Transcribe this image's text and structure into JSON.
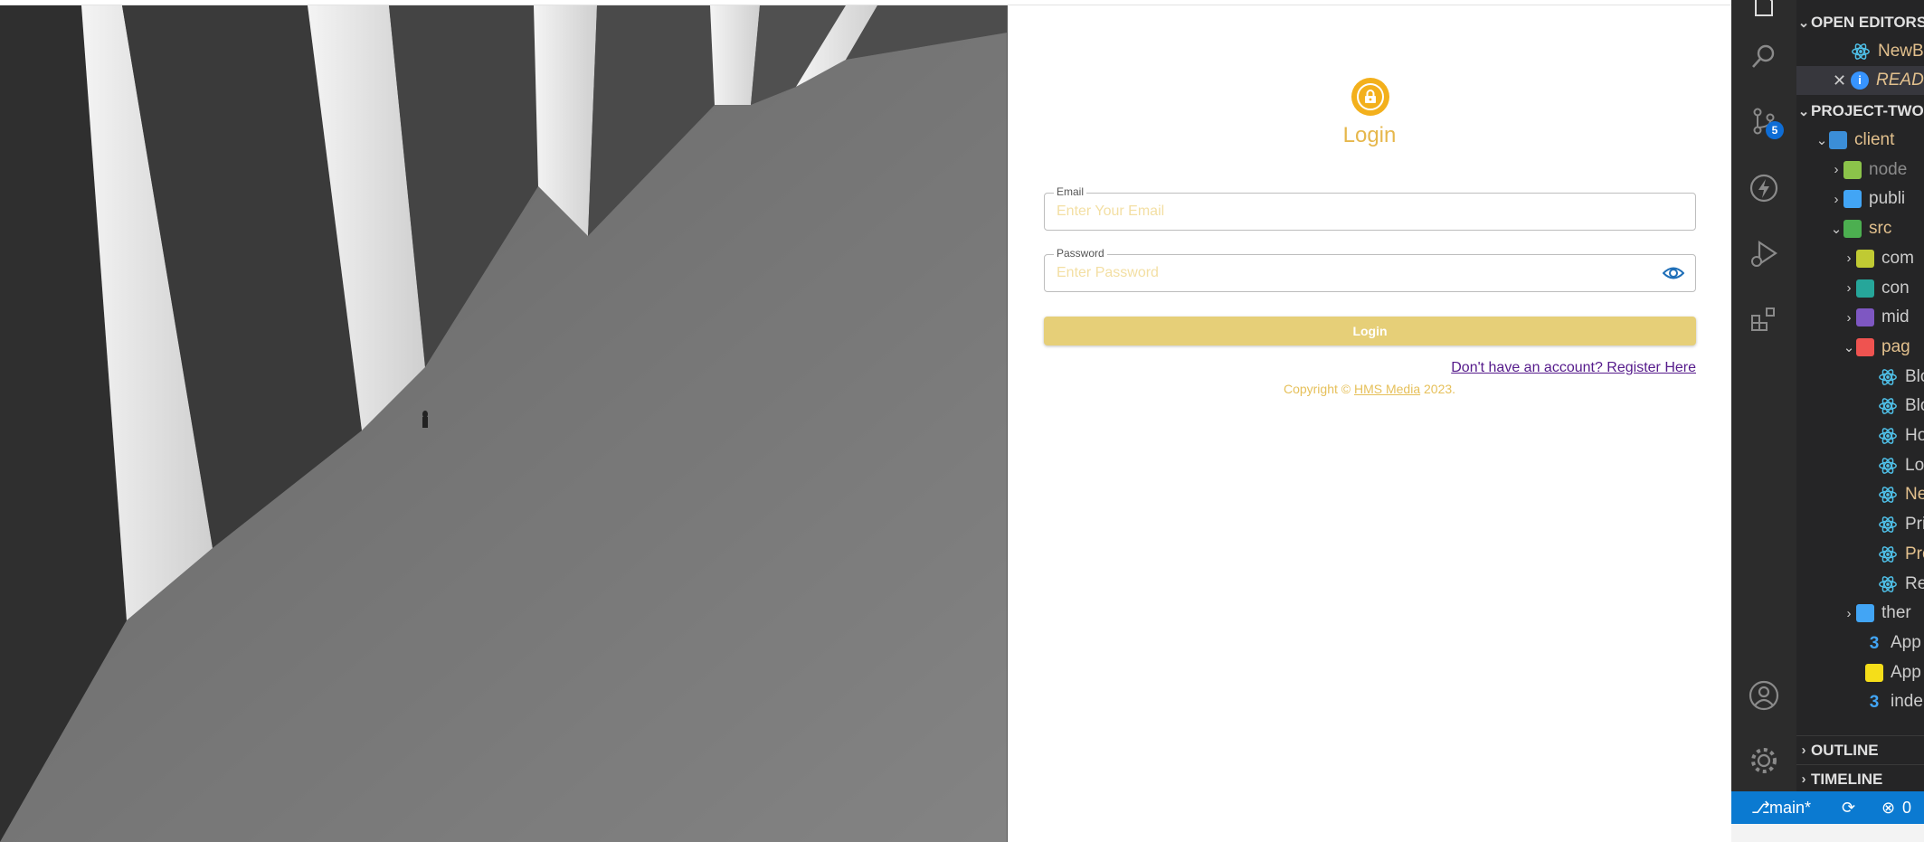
{
  "login": {
    "title": "Login",
    "email_label": "Email",
    "email_placeholder": "Enter Your Email",
    "password_label": "Password",
    "password_placeholder": "Enter Password",
    "button_label": "Login",
    "register_link": "Don't have an account? Register Here",
    "copyright_prefix": "Copyright © ",
    "copyright_brand": "HMS Media",
    "copyright_year": " 2023.",
    "accent_color": "#f3b01c"
  },
  "vscode": {
    "activity_icons": [
      "explorer-icon",
      "search-icon",
      "source-control-icon",
      "thunder-icon",
      "run-debug-icon",
      "extensions-icon",
      "account-icon",
      "settings-gear-icon"
    ],
    "scm_badge": "5",
    "sidebar": {
      "open_editors_header": "OPEN EDITORS",
      "open_editors": [
        {
          "label": "NewB",
          "icon": "react-icon",
          "color": "#e2c08d"
        },
        {
          "label": "READ",
          "icon": "info-icon",
          "color": "#e2c08d"
        }
      ],
      "project_header": "PROJECT-TWO",
      "tree": [
        {
          "label": "client",
          "icon": "folder-client-icon",
          "color": "#e2c08d"
        },
        {
          "label": "node",
          "icon": "folder-node-icon",
          "color": "#8b8b8b"
        },
        {
          "label": "publi",
          "icon": "folder-public-icon",
          "color": "#cccccc"
        },
        {
          "label": "src",
          "icon": "folder-src-icon",
          "color": "#e2c08d"
        },
        {
          "label": "com",
          "icon": "folder-components-icon",
          "color": "#cccccc"
        },
        {
          "label": "con",
          "icon": "folder-context-icon",
          "color": "#cccccc"
        },
        {
          "label": "mid",
          "icon": "folder-middleware-icon",
          "color": "#cccccc"
        },
        {
          "label": "pag",
          "icon": "folder-pages-icon",
          "color": "#e2c08d"
        },
        {
          "label": "Blo",
          "icon": "react-icon",
          "color": "#cccccc"
        },
        {
          "label": "Blo",
          "icon": "react-icon",
          "color": "#cccccc"
        },
        {
          "label": "Ho",
          "icon": "react-icon",
          "color": "#cccccc"
        },
        {
          "label": "Lo",
          "icon": "react-icon",
          "color": "#cccccc"
        },
        {
          "label": "Ne",
          "icon": "react-icon",
          "color": "#e2c08d"
        },
        {
          "label": "Pri",
          "icon": "react-icon",
          "color": "#cccccc"
        },
        {
          "label": "Pro",
          "icon": "react-icon",
          "color": "#e2c08d"
        },
        {
          "label": "Re",
          "icon": "react-icon",
          "color": "#cccccc"
        },
        {
          "label": "ther",
          "icon": "folder-theme-icon",
          "color": "#cccccc"
        },
        {
          "label": "App",
          "icon": "css-file-icon",
          "color": "#cccccc"
        },
        {
          "label": "App",
          "icon": "js-file-icon",
          "color": "#cccccc"
        },
        {
          "label": "inde",
          "icon": "css-file-icon",
          "color": "#cccccc"
        }
      ],
      "outline_header": "OUTLINE",
      "timeline_header": "TIMELINE"
    },
    "statusbar": {
      "branch": "main*",
      "errors": "0"
    }
  }
}
